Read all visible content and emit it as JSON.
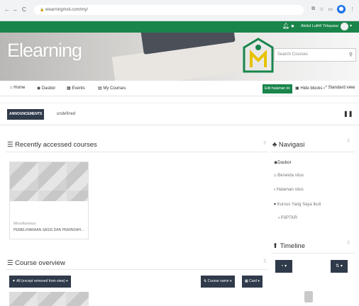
{
  "browser": {
    "url": "elearningmsti.com/my/",
    "back": "←",
    "forward": "→",
    "reload": "C",
    "lock": "🔒",
    "ext1": "⧉",
    "star": "☆",
    "ext2": "▭",
    "profile": "●"
  },
  "topbar": {
    "bell_icon": "bell-icon",
    "chat_icon": "chat-icon",
    "user_name": "Abdul Luthfi Tirtayasa",
    "color": "#19854b"
  },
  "header": {
    "brand": "Elearning",
    "search_placeholder": "Search Courses"
  },
  "nav": {
    "home": "Home",
    "dasbor": "Dasbor",
    "events": "Events",
    "my_courses": "My Courses",
    "edit": "Edit halaman ini",
    "hide_blocks": "Hide blocks",
    "standard_view": "Standard view"
  },
  "announcement": {
    "badge": "ANNOUNCEMENTS",
    "text": "undefined"
  },
  "recent": {
    "title": "Recently accessed courses",
    "card": {
      "category": "Miscellaneous",
      "name": "PEMELIHARAAN SASIS DAN PEMINDAH..."
    }
  },
  "overview": {
    "title": "Course overview",
    "filter": "All (except removed from view)",
    "sort": "Course name",
    "view": "Card"
  },
  "navigasi": {
    "title": "Navigasi",
    "items": [
      "Dasbor",
      "Beranda situs",
      "Halaman situs",
      "Kursus Yang Saya Ikuti",
      "P3PTKR"
    ]
  },
  "timeline": {
    "title": "Timeline",
    "btn1": "◔",
    "btn2": "⇅"
  }
}
